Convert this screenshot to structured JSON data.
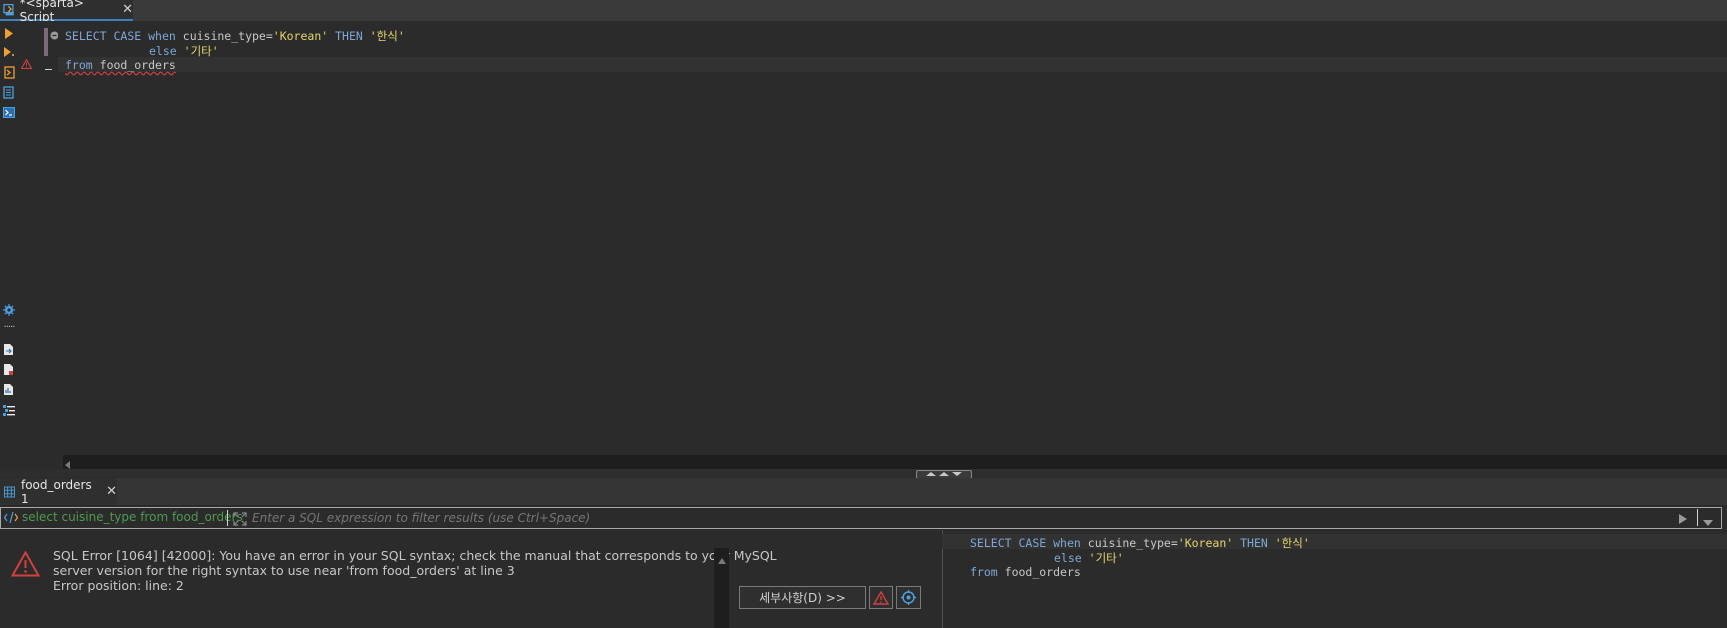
{
  "editor_tab": {
    "title": "*<sparta> Script"
  },
  "code": {
    "line1": {
      "kw_select": "SELECT",
      "kw_case": "CASE",
      "kw_when": "when",
      "ident": "cuisine_type=",
      "str1": "'Korean'",
      "kw_then": "THEN",
      "str2": "'한식'"
    },
    "line2": {
      "kw_else": "else",
      "str": "'기타'"
    },
    "line3": {
      "kw_from": "from",
      "ident": "food_orders"
    }
  },
  "results": {
    "tab_label": "food_orders 1",
    "filter": {
      "query_text": "select cuisine_type from food_orders",
      "placeholder": "Enter a SQL expression to filter results (use Ctrl+Space)"
    },
    "error": {
      "line1": "SQL Error [1064] [42000]: You have an error in your SQL syntax; check the manual that corresponds to your MySQL",
      "line2": "server version for the right syntax to use near 'from food_orders' at line 3",
      "line3": "Error position: line: 2"
    },
    "details_button": "세부사항(D) >>"
  },
  "colors": {
    "accent": "#3b82c4",
    "keyword": "#7fa7d6",
    "string": "#e6d46b",
    "error": "#d04040",
    "filter_query": "#4e9a4e"
  }
}
